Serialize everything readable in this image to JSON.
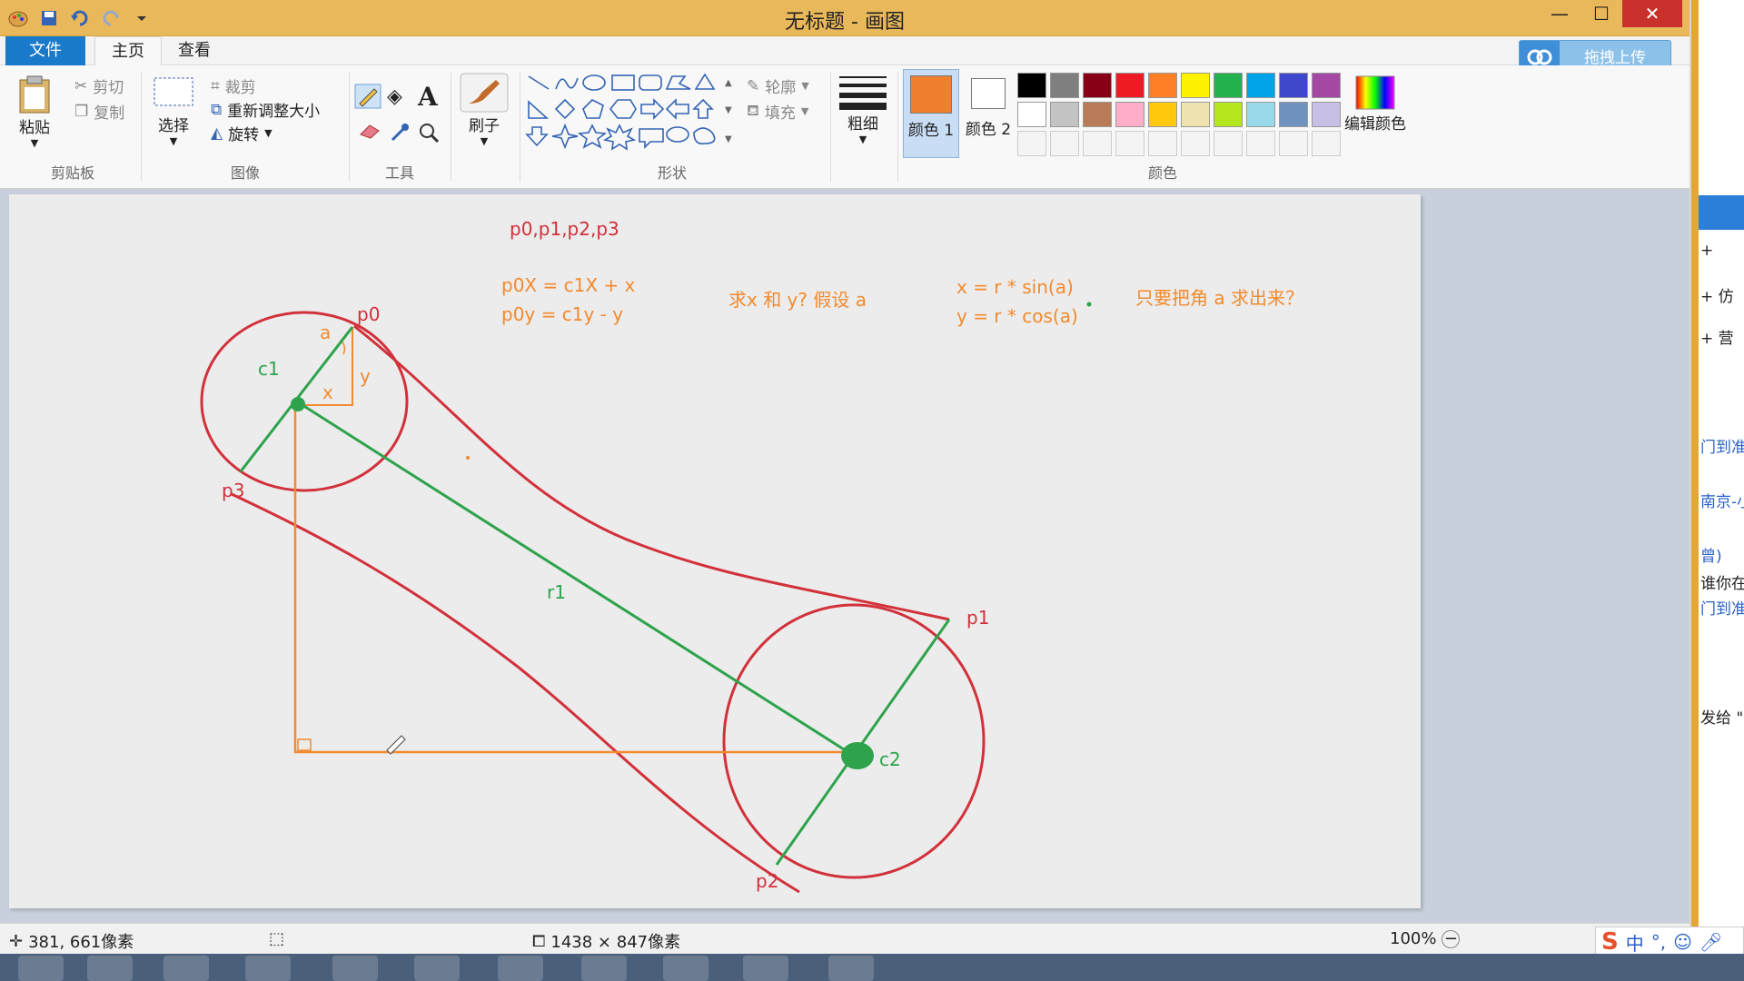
{
  "window": {
    "title": "无标题 - 画图",
    "minimize": "—",
    "maximize": "☐",
    "close": "✕"
  },
  "tabs": {
    "file": "文件",
    "home": "主页",
    "view": "查看"
  },
  "cloud": {
    "label": "拖拽上传"
  },
  "ribbon": {
    "clipboard": {
      "paste": "粘贴",
      "cut": "剪切",
      "copy": "复制",
      "group": "剪贴板"
    },
    "image": {
      "select": "选择",
      "crop": "裁剪",
      "resize": "重新调整大小",
      "rotate": "旋转",
      "group": "图像"
    },
    "tools": {
      "group": "工具"
    },
    "brush": {
      "label": "刷子"
    },
    "shapes": {
      "group": "形状",
      "outline": "轮廓",
      "fill": "填充"
    },
    "size": {
      "label": "粗细"
    },
    "colors": {
      "color1": "颜色 1",
      "color2": "颜色 2",
      "edit": "编辑颜色",
      "group": "颜色",
      "color1_value": "#f08030",
      "row1": [
        "#000000",
        "#7f7f7f",
        "#880015",
        "#ed1c24",
        "#ff7f27",
        "#fff200",
        "#22b14c",
        "#00a2e8",
        "#3f48cc",
        "#a349a4"
      ],
      "row2": [
        "#ffffff",
        "#c3c3c3",
        "#b97a57",
        "#ffaec9",
        "#ffc90e",
        "#efe4b0",
        "#b5e61d",
        "#99d9ea",
        "#7092be",
        "#c8bfe7"
      ]
    }
  },
  "canvas": {
    "notes": {
      "points": "p0,p1,p2,p3",
      "p0x": "p0X = c1X + x",
      "p0y": "p0y =  c1y - y",
      "question": "求x 和 y? 假设 a",
      "xformula": "x = r * sin(a)",
      "yformula": "y = r * cos(a)",
      "angle": "只要把角 a 求出来？"
    },
    "labels": {
      "p0": "p0",
      "p1": "p1",
      "p2": "p2",
      "p3": "p3",
      "c1": "c1",
      "c2": "c2",
      "r1": "r1",
      "a": "a",
      "x": "x",
      "y": "y"
    },
    "colors": {
      "red": "#d2313b",
      "green": "#2ea34b",
      "orange": "#f28a2e"
    }
  },
  "status": {
    "cursor": "381, 661像素",
    "size": "1438 × 847像素",
    "zoom": "100%"
  },
  "right_window": {
    "items": [
      "+",
      "+ 仿",
      "+ 营",
      "门到准",
      "南京-小",
      "曾)",
      "谁你在",
      "门到准",
      "发给 \"I"
    ]
  },
  "ime": {
    "mode": "中",
    "punct": "°,"
  }
}
